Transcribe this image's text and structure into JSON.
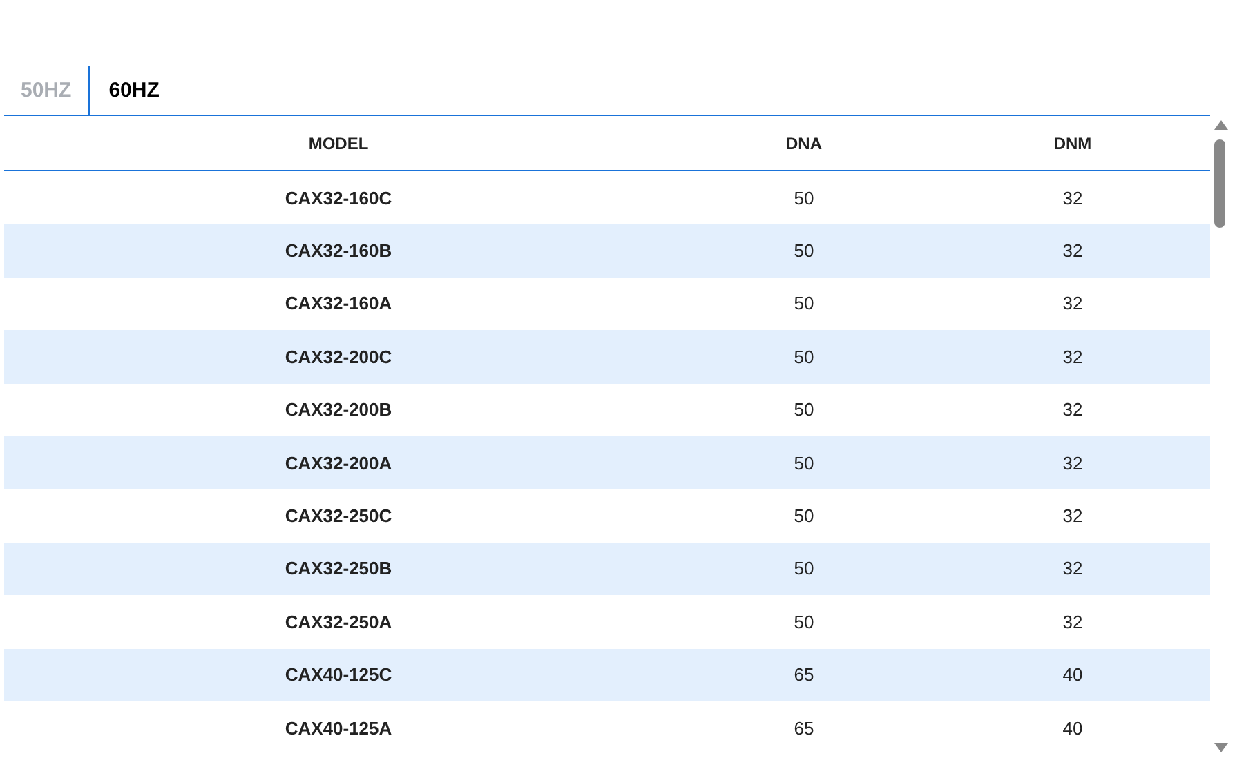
{
  "tabs": [
    {
      "label": "50HZ",
      "selected": false
    },
    {
      "label": "60HZ",
      "selected": true
    }
  ],
  "table": {
    "columns": [
      "MODEL",
      "DNA",
      "DNM"
    ],
    "rows": [
      [
        "CAX32-160C",
        "50",
        "32"
      ],
      [
        "CAX32-160B",
        "50",
        "32"
      ],
      [
        "CAX32-160A",
        "50",
        "32"
      ],
      [
        "CAX32-200C",
        "50",
        "32"
      ],
      [
        "CAX32-200B",
        "50",
        "32"
      ],
      [
        "CAX32-200A",
        "50",
        "32"
      ],
      [
        "CAX32-250C",
        "50",
        "32"
      ],
      [
        "CAX32-250B",
        "50",
        "32"
      ],
      [
        "CAX32-250A",
        "50",
        "32"
      ],
      [
        "CAX40-125C",
        "65",
        "40"
      ],
      [
        "CAX40-125A",
        "65",
        "40"
      ]
    ]
  }
}
